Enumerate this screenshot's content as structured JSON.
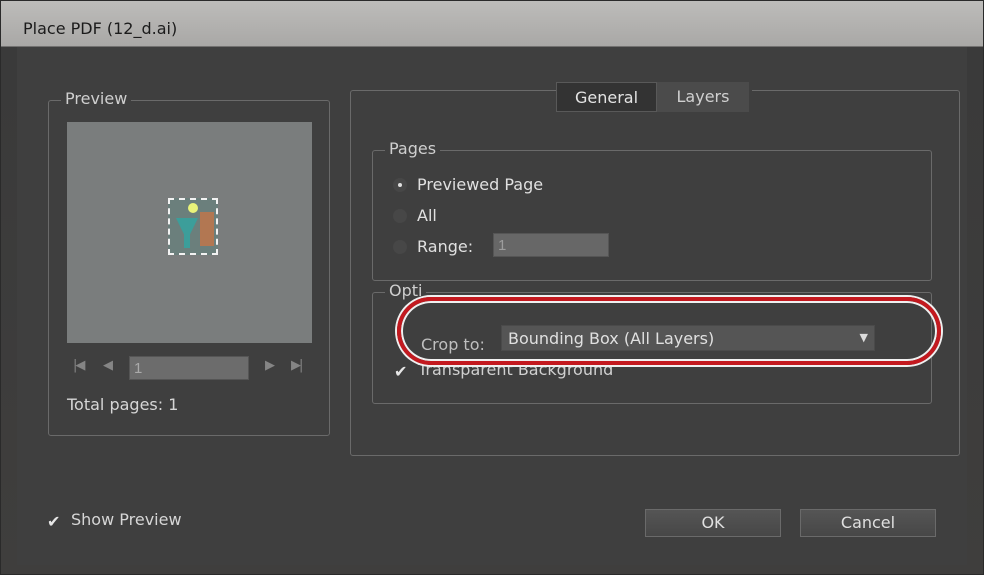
{
  "window": {
    "title": "Place PDF (12_d.ai)"
  },
  "preview": {
    "group_label": "Preview",
    "page_value": "1",
    "total_pages": "Total pages: 1",
    "nav_icons": [
      "first-page-icon",
      "prev-page-icon",
      "next-page-icon",
      "last-page-icon"
    ]
  },
  "tabs": [
    {
      "label": "General",
      "active": true
    },
    {
      "label": "Layers",
      "active": false
    }
  ],
  "pages": {
    "group_label": "Pages",
    "options": [
      {
        "label": "Previewed Page",
        "checked": true
      },
      {
        "label": "All",
        "checked": false
      },
      {
        "label": "Range:",
        "checked": false
      }
    ],
    "range_value": "1"
  },
  "options": {
    "group_label": "Opti",
    "crop_label": "Crop to:",
    "crop_value": "Bounding Box (All Layers)",
    "transparent_label": "Transparent Background",
    "transparent_checked": true
  },
  "show_preview": {
    "label": "Show Preview",
    "checked": true
  },
  "buttons": {
    "ok": "OK",
    "cancel": "Cancel"
  },
  "colors": {
    "highlight": "#c3191f",
    "dialog_bg": "#3f3f3f"
  }
}
